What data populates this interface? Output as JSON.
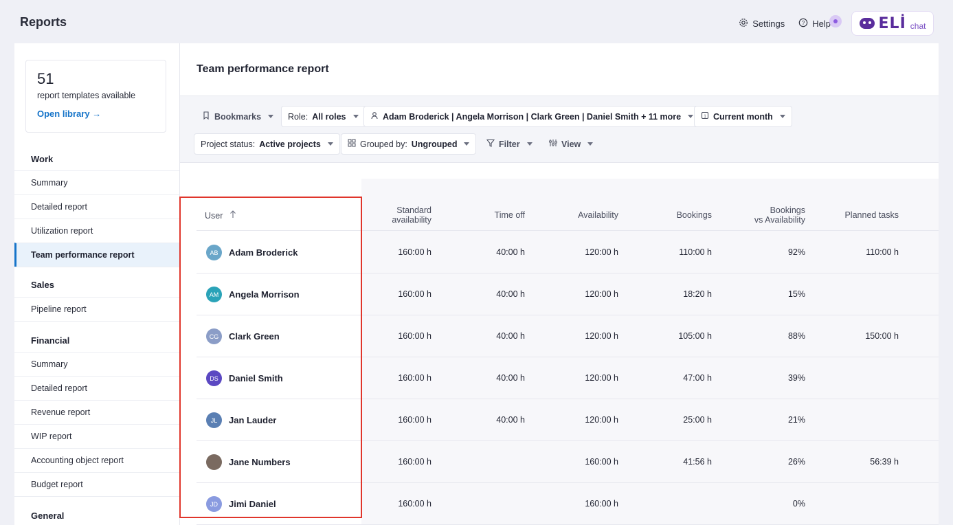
{
  "app": {
    "title": "Reports"
  },
  "topbar": {
    "settings_label": "Settings",
    "help_label": "Help",
    "eli_label": "ELİ",
    "eli_sub": "chat"
  },
  "library": {
    "count": "51",
    "description": "report templates available",
    "link_label": "Open library →"
  },
  "nav": {
    "work": {
      "title": "Work",
      "items": [
        "Summary",
        "Detailed report",
        "Utilization report",
        "Team performance report"
      ]
    },
    "sales": {
      "title": "Sales",
      "items": [
        "Pipeline report"
      ]
    },
    "financial": {
      "title": "Financial",
      "items": [
        "Summary",
        "Detailed report",
        "Revenue report",
        "WIP report",
        "Accounting object report",
        "Budget report"
      ]
    },
    "general": {
      "title": "General"
    }
  },
  "page": {
    "title": "Team performance report"
  },
  "filters": {
    "bookmarks": "Bookmarks",
    "role_prefix": "Role:",
    "role_value": "All roles",
    "people_value": "Adam Broderick | Angela Morrison | Clark Green | Daniel Smith + 11 more",
    "period_value": "Current month",
    "status_prefix": "Project status:",
    "status_value": "Active projects",
    "grouped_prefix": "Grouped by:",
    "grouped_value": "Ungrouped",
    "filter_label": "Filter",
    "view_label": "View"
  },
  "table": {
    "headers": {
      "user": "User",
      "standard_1": "Standard",
      "standard_2": "availability",
      "time_off": "Time off",
      "availability": "Availability",
      "bookings": "Bookings",
      "bva_1": "Bookings",
      "bva_2": "vs Availability",
      "planned": "Planned tasks"
    },
    "rows": [
      {
        "initials": "AB",
        "color": "#6aa6c9",
        "name": "Adam Broderick",
        "standard": "160:00 h",
        "time_off": "40:00 h",
        "availability": "120:00 h",
        "bookings": "110:00 h",
        "bva": "92%",
        "planned": "110:00 h"
      },
      {
        "initials": "AM",
        "color": "#2aa3b8",
        "name": "Angela Morrison",
        "standard": "160:00 h",
        "time_off": "40:00 h",
        "availability": "120:00 h",
        "bookings": "18:20 h",
        "bva": "15%",
        "planned": ""
      },
      {
        "initials": "CG",
        "color": "#8b9dc7",
        "name": "Clark Green",
        "standard": "160:00 h",
        "time_off": "40:00 h",
        "availability": "120:00 h",
        "bookings": "105:00 h",
        "bva": "88%",
        "planned": "150:00 h"
      },
      {
        "initials": "DS",
        "color": "#5b48c2",
        "name": "Daniel Smith",
        "standard": "160:00 h",
        "time_off": "40:00 h",
        "availability": "120:00 h",
        "bookings": "47:00 h",
        "bva": "39%",
        "planned": ""
      },
      {
        "initials": "JL",
        "color": "#5a7fb3",
        "name": "Jan Lauder",
        "standard": "160:00 h",
        "time_off": "40:00 h",
        "availability": "120:00 h",
        "bookings": "25:00 h",
        "bva": "21%",
        "planned": ""
      },
      {
        "initials": "",
        "color": "#7a6a60",
        "name": "Jane Numbers",
        "standard": "160:00 h",
        "time_off": "",
        "availability": "160:00 h",
        "bookings": "41:56 h",
        "bva": "26%",
        "planned": "56:39 h"
      },
      {
        "initials": "JD",
        "color": "#8a9be0",
        "name": "Jimi Daniel",
        "standard": "160:00 h",
        "time_off": "",
        "availability": "160:00 h",
        "bookings": "",
        "bva": "0%",
        "planned": ""
      }
    ]
  },
  "colors": {
    "accent": "#1674c9",
    "highlight": "#e0352b",
    "eli": "#5a2d9c"
  }
}
